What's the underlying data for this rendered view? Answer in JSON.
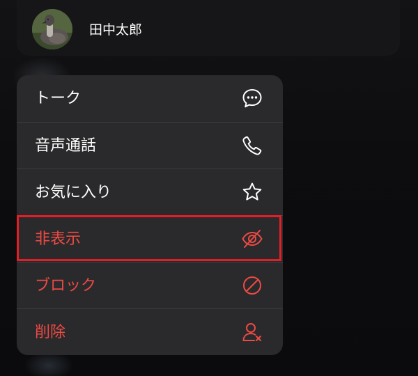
{
  "contact": {
    "name": "田中太郎",
    "avatar_icon": "duck-photo"
  },
  "menu": {
    "items": [
      {
        "label": "トーク",
        "icon": "chat-bubble-icon",
        "destructive": false
      },
      {
        "label": "音声通話",
        "icon": "phone-icon",
        "destructive": false
      },
      {
        "label": "お気に入り",
        "icon": "star-icon",
        "destructive": false
      },
      {
        "label": "非表示",
        "icon": "eye-slash-icon",
        "destructive": true,
        "highlighted": true
      },
      {
        "label": "ブロック",
        "icon": "block-icon",
        "destructive": true
      },
      {
        "label": "削除",
        "icon": "delete-user-icon",
        "destructive": true
      }
    ]
  },
  "colors": {
    "background": "#0b0b0d",
    "menu_background": "#2a2a2c",
    "text": "#ffffff",
    "destructive": "#ee4a44",
    "highlight_border": "#e21e26"
  }
}
